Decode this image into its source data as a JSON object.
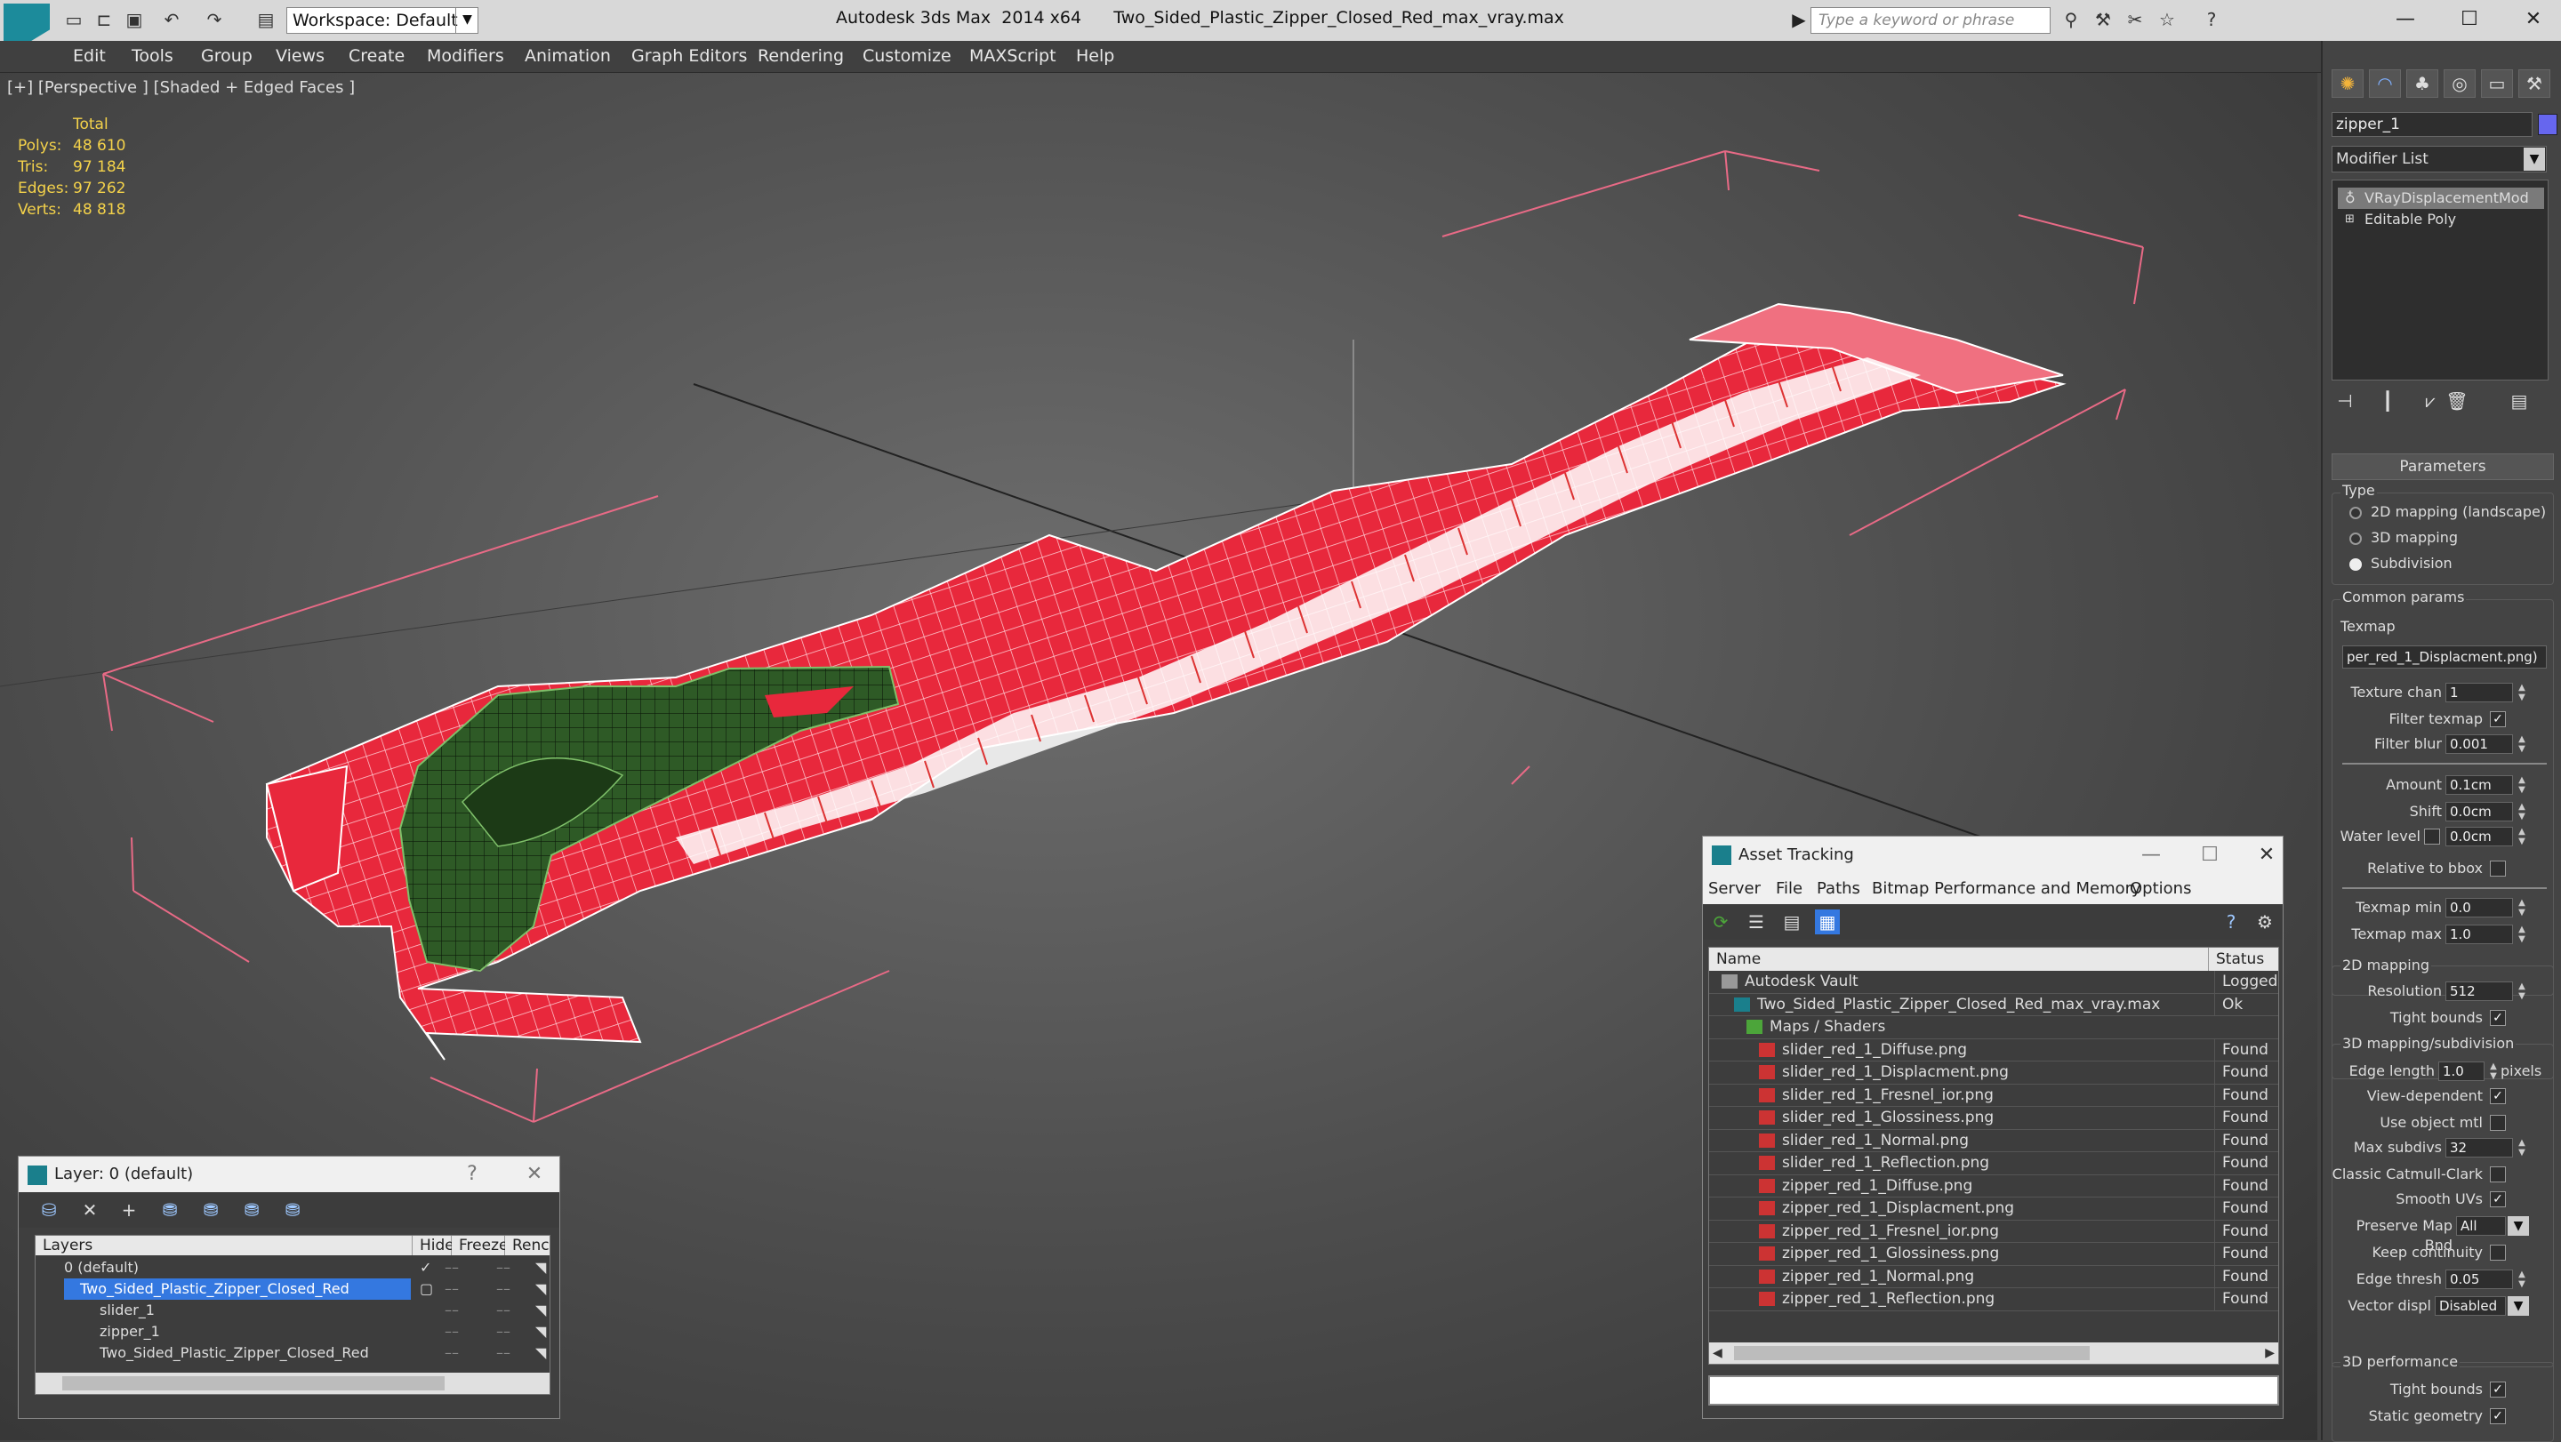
{
  "app": {
    "title": "Autodesk 3ds Max  2014 x64      Two_Sided_Plastic_Zipper_Closed_Red_max_vray.max",
    "workspace": "Workspace: Default",
    "search_placeholder": "Type a keyword or phrase"
  },
  "menu": [
    "Edit",
    "Tools",
    "Group",
    "Views",
    "Create",
    "Modifiers",
    "Animation",
    "Graph Editors",
    "Rendering",
    "Customize",
    "MAXScript",
    "Help"
  ],
  "viewport": {
    "label": "[+] [Perspective ] [Shaded + Edged Faces ]",
    "stats": {
      "header": "Total",
      "rows": [
        {
          "k": "Polys:",
          "v": "48 610"
        },
        {
          "k": "Tris:",
          "v": "97 184"
        },
        {
          "k": "Edges:",
          "v": "97 262"
        },
        {
          "k": "Verts:",
          "v": "48 818"
        }
      ]
    }
  },
  "command_panel": {
    "object_name": "zipper_1",
    "object_color": "#6666ee",
    "modifier_list": "Modifier List",
    "stack": [
      "VRayDisplacementMod",
      "Editable Poly"
    ],
    "rollout": "Parameters",
    "type_group": "Type",
    "type_options": [
      {
        "label": "2D mapping (landscape)",
        "on": false
      },
      {
        "label": "3D mapping",
        "on": false
      },
      {
        "label": "Subdivision",
        "on": true
      }
    ],
    "common_group": "Common params",
    "texmap_label": "Texmap",
    "texmap_value": "per_red_1_Displacment.png)",
    "params1": [
      {
        "label": "Texture chan",
        "value": "1"
      },
      {
        "label": "Filter texmap",
        "check": true
      },
      {
        "label": "Filter blur",
        "value": "0.001"
      },
      {
        "label": "Amount",
        "value": "0.1cm"
      },
      {
        "label": "Shift",
        "value": "0.0cm"
      },
      {
        "label": "Water level",
        "value": "0.0cm"
      },
      {
        "label": "Relative to bbox",
        "check": false
      },
      {
        "label": "Texmap min",
        "value": "0.0"
      },
      {
        "label": "Texmap max",
        "value": "1.0"
      }
    ],
    "g2d_group": "2D mapping",
    "params2": [
      {
        "label": "Resolution",
        "value": "512"
      },
      {
        "label": "Tight bounds",
        "check": true
      }
    ],
    "g3d_group": "3D mapping/subdivision",
    "edge_length_label": "Edge length",
    "edge_length_value": "1.0",
    "edge_length_unit": "pixels",
    "params3": [
      {
        "label": "View-dependent",
        "check": true
      },
      {
        "label": "Use object mtl",
        "check": false
      },
      {
        "label": "Max subdivs",
        "value": "32"
      },
      {
        "label": "Classic Catmull-Clark",
        "check": false
      },
      {
        "label": "Smooth UVs",
        "check": true
      },
      {
        "label": "Preserve Map Bnd",
        "value": "All"
      },
      {
        "label": "Keep continuity",
        "check": false
      },
      {
        "label": "Edge thresh",
        "value": "0.05"
      },
      {
        "label": "Vector displ",
        "value": "Disabled"
      }
    ],
    "perf_group": "3D performance",
    "params4": [
      {
        "label": "Tight bounds",
        "check": true
      },
      {
        "label": "Static geometry",
        "check": true
      }
    ]
  },
  "layer_panel": {
    "title": "Layer: 0 (default)",
    "help": "?",
    "columns": [
      "Layers",
      "Hide",
      "Freeze",
      "Renc"
    ],
    "rows": [
      {
        "name": "0 (default)",
        "indent": 1,
        "sel": false
      },
      {
        "name": "Two_Sided_Plastic_Zipper_Closed_Red",
        "indent": 1,
        "sel": true
      },
      {
        "name": "slider_1",
        "indent": 2,
        "sel": false
      },
      {
        "name": "zipper_1",
        "indent": 2,
        "sel": false
      },
      {
        "name": "Two_Sided_Plastic_Zipper_Closed_Red",
        "indent": 2,
        "sel": false
      }
    ]
  },
  "asset_panel": {
    "title": "Asset Tracking",
    "menu": [
      "Server",
      "File",
      "Paths",
      "Bitmap Performance and Memory",
      "Options"
    ],
    "columns": [
      "Name",
      "Status"
    ],
    "rows": [
      {
        "name": "Autodesk Vault",
        "status": "Logged O",
        "indent": 0,
        "kind": "vault"
      },
      {
        "name": "Two_Sided_Plastic_Zipper_Closed_Red_max_vray.max",
        "status": "Ok",
        "indent": 1,
        "kind": "max"
      },
      {
        "name": "Maps / Shaders",
        "status": "",
        "indent": 2,
        "kind": "folder"
      },
      {
        "name": "slider_red_1_Diffuse.png",
        "status": "Found",
        "indent": 3,
        "kind": "file"
      },
      {
        "name": "slider_red_1_Displacment.png",
        "status": "Found",
        "indent": 3,
        "kind": "file"
      },
      {
        "name": "slider_red_1_Fresnel_ior.png",
        "status": "Found",
        "indent": 3,
        "kind": "file"
      },
      {
        "name": "slider_red_1_Glossiness.png",
        "status": "Found",
        "indent": 3,
        "kind": "file"
      },
      {
        "name": "slider_red_1_Normal.png",
        "status": "Found",
        "indent": 3,
        "kind": "file"
      },
      {
        "name": "slider_red_1_Reflection.png",
        "status": "Found",
        "indent": 3,
        "kind": "file"
      },
      {
        "name": "zipper_red_1_Diffuse.png",
        "status": "Found",
        "indent": 3,
        "kind": "file"
      },
      {
        "name": "zipper_red_1_Displacment.png",
        "status": "Found",
        "indent": 3,
        "kind": "file"
      },
      {
        "name": "zipper_red_1_Fresnel_ior.png",
        "status": "Found",
        "indent": 3,
        "kind": "file"
      },
      {
        "name": "zipper_red_1_Glossiness.png",
        "status": "Found",
        "indent": 3,
        "kind": "file"
      },
      {
        "name": "zipper_red_1_Normal.png",
        "status": "Found",
        "indent": 3,
        "kind": "file"
      },
      {
        "name": "zipper_red_1_Reflection.png",
        "status": "Found",
        "indent": 3,
        "kind": "file"
      }
    ]
  }
}
